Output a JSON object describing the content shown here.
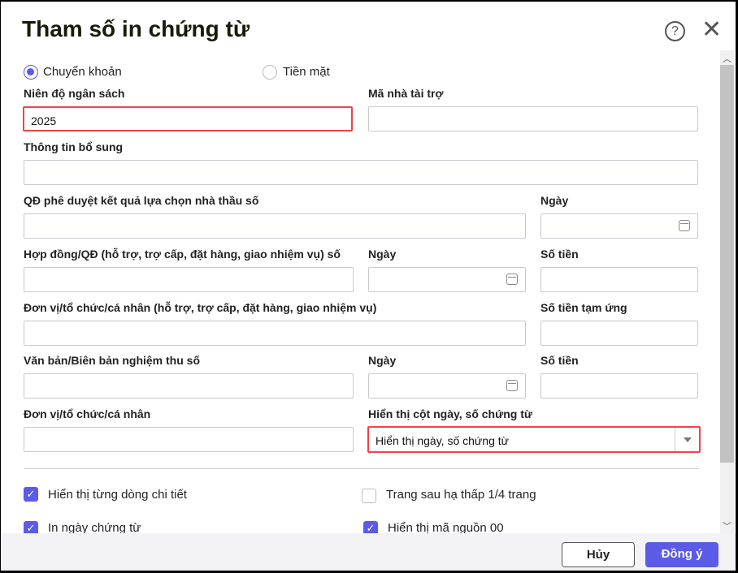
{
  "title": "Tham số in chứng từ",
  "payment": {
    "transfer": "Chuyển khoản",
    "cash": "Tiền mặt",
    "selected": "transfer"
  },
  "fields": {
    "budget_year": {
      "label": "Niên độ ngân sách",
      "value": "2025"
    },
    "sponsor_code": {
      "label": "Mã nhà tài trợ",
      "value": ""
    },
    "additional_info": {
      "label": "Thông tin bổ sung",
      "value": ""
    },
    "contractor_decision": {
      "label": "QĐ phê duyệt kết quả lựa chọn nhà thầu số",
      "value": ""
    },
    "contractor_date": {
      "label": "Ngày",
      "value": ""
    },
    "contract_no": {
      "label": "Hợp đồng/QĐ (hỗ trợ, trợ cấp, đặt hàng, giao nhiệm vụ) số",
      "value": ""
    },
    "contract_date": {
      "label": "Ngày",
      "value": ""
    },
    "contract_amount": {
      "label": "Số tiền",
      "value": ""
    },
    "org_unit": {
      "label": "Đơn vị/tổ chức/cá nhân (hỗ trợ, trợ cấp, đặt hàng, giao nhiệm vụ)",
      "value": ""
    },
    "advance_amount": {
      "label": "Số tiền tạm ứng",
      "value": ""
    },
    "acceptance_doc": {
      "label": "Văn bản/Biên bản nghiệm thu số",
      "value": ""
    },
    "acceptance_date": {
      "label": "Ngày",
      "value": ""
    },
    "acceptance_amount": {
      "label": "Số tiền",
      "value": ""
    },
    "unit": {
      "label": "Đơn vị/tổ chức/cá nhân",
      "value": ""
    },
    "display_column": {
      "label": "Hiển thị cột ngày, số chứng từ",
      "value": "Hiển thị ngày, số chứng từ"
    }
  },
  "options": [
    {
      "label": "Hiển thị từng dòng chi tiết",
      "checked": true
    },
    {
      "label": "Trang sau hạ thấp 1/4 trang",
      "checked": false
    },
    {
      "label": "In ngày chứng từ",
      "checked": true
    },
    {
      "label": "Hiển thị mã nguồn 00",
      "checked": true
    }
  ],
  "buttons": {
    "cancel": "Hủy",
    "ok": "Đồng ý"
  },
  "colors": {
    "accent": "#5b5be8",
    "highlight": "#f0434a"
  }
}
